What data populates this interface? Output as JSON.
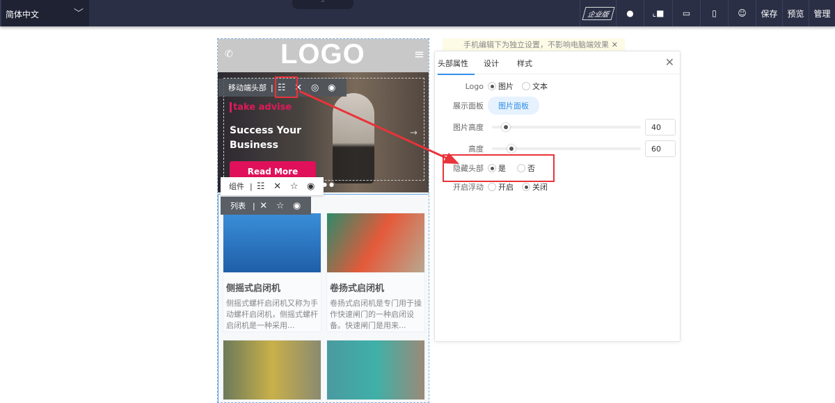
{
  "topbar": {
    "language": "简体中文",
    "edition": "企业版",
    "save": "保存",
    "preview": "预览",
    "manage": "管理"
  },
  "phone": {
    "logo": "LOGO",
    "banner": {
      "tag": "take advise",
      "title_line1": "Success Your",
      "title_line2": "Business",
      "button": "Read More"
    },
    "toolbars": {
      "header": "移动端头部",
      "component": "组件",
      "list": "列表"
    },
    "cards": [
      {
        "title": "侧摇式启闭机",
        "desc": "侧摇式螺杆启闭机又称为手动螺杆启闭机，侧摇式螺杆启闭机是一种采用..."
      },
      {
        "title": "卷扬式启闭机",
        "desc": "卷扬式启闭机是专门用于操作快速闸门的一种启闭设备。快速闸门是用来..."
      }
    ]
  },
  "tip": "手机编辑下为独立设置，不影响电脑端效果",
  "panel": {
    "tabs": [
      "头部属性",
      "设计",
      "样式"
    ],
    "logo_label": "Logo",
    "logo_opt1": "图片",
    "logo_opt2": "文本",
    "display_label": "展示面板",
    "display_btn": "图片面板",
    "img_height_label": "图片高度",
    "img_height": "40",
    "height_label": "高度",
    "height": "60",
    "hide_label": "隐藏头部",
    "hide_yes": "是",
    "hide_no": "否",
    "float_label": "开启浮动",
    "float_on": "开启",
    "float_off": "关闭"
  },
  "accent": "#2f8fe8",
  "highlight": "#e8333a"
}
